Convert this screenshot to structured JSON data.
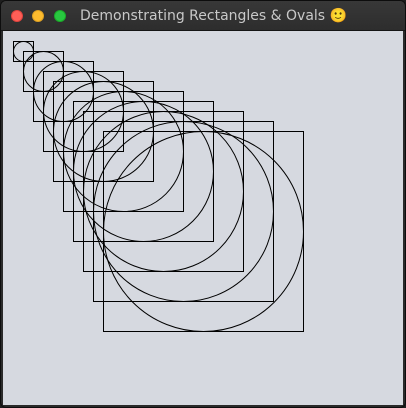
{
  "window": {
    "title": "Demonstrating Rectangles & Ovals",
    "title_emoji": "🙂",
    "controls": [
      "close-button",
      "minimize-button",
      "zoom-button"
    ],
    "colors": {
      "titlebar": "#2d2d2d",
      "canvas": "#d6d9e0",
      "stroke": "#000000",
      "close": "#fe5f57",
      "minimize": "#febc2e",
      "zoom": "#28c840"
    }
  },
  "canvas": {
    "shapes": [
      "rectangle",
      "oval"
    ],
    "pairs": 10
  }
}
